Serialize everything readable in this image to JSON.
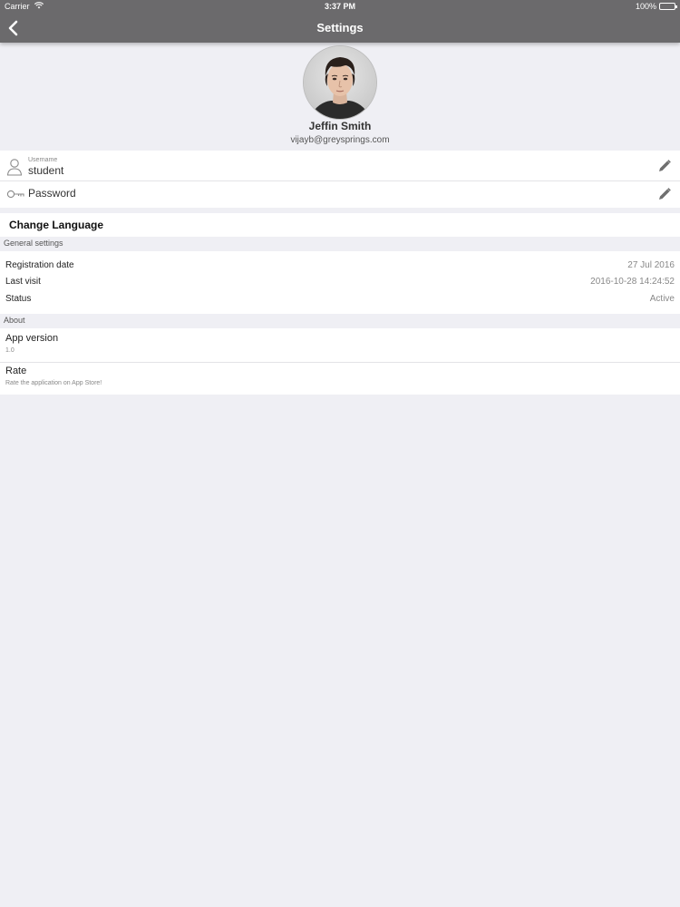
{
  "status_bar": {
    "carrier": "Carrier",
    "time": "3:37 PM",
    "battery": "100%",
    "battery_level": 1.0
  },
  "nav": {
    "title": "Settings",
    "back_icon": "chevron-left-icon"
  },
  "profile": {
    "name": "Jeffin Smith",
    "email": "vijayb@greysprings.com"
  },
  "account": {
    "username_label": "Username",
    "username_value": "student",
    "password_label": "Password",
    "user_icon": "user-icon",
    "key_icon": "key-icon",
    "edit_icon": "pencil-icon"
  },
  "change_language": "Change Language",
  "general_settings": {
    "header": "General settings",
    "rows": [
      {
        "label": "Registration date",
        "value": "27 Jul 2016"
      },
      {
        "label": "Last visit",
        "value": "2016-10-28 14:24:52"
      },
      {
        "label": "Status",
        "value": "Active"
      }
    ]
  },
  "about": {
    "header": "About",
    "app_version_label": "App version",
    "app_version_value": "1.0",
    "rate_label": "Rate",
    "rate_sub": "Rate the application on App Store!"
  },
  "colors": {
    "topbar": "#6b6a6c",
    "background": "#efeff4",
    "card": "#ffffff"
  }
}
